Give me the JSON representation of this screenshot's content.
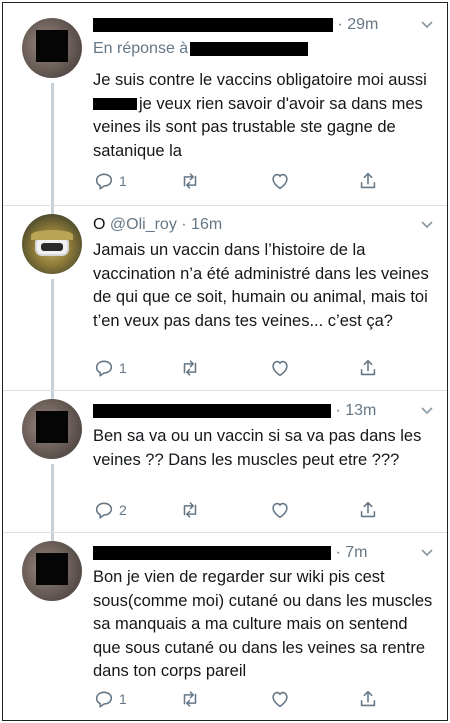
{
  "tweets": [
    {
      "name": "",
      "handle": "",
      "time": "· 29m",
      "reply_prefix": "En réponse à",
      "text_before": "Je suis contre le vaccins obligatoire moi aussi ",
      "text_after": "je veux rien savoir d'avoir sa dans mes veines ils sont pas trustable ste gagne de satanique la",
      "replies": "1",
      "retweets": "",
      "likes": ""
    },
    {
      "name": "O",
      "handle": "@Oli_roy",
      "time": "· 16m",
      "text": "Jamais un vaccin dans l’histoire de la vaccination n’a été administré dans les veines de qui que ce soit, humain ou animal, mais toi t’en veux pas dans tes veines... c’est ça?",
      "replies": "1",
      "retweets": "",
      "likes": ""
    },
    {
      "name": "",
      "handle": "",
      "time": "· 13m",
      "text": "Ben sa va ou un vaccin si sa va pas dans les veines ?? Dans les muscles peut etre ???",
      "replies": "2",
      "retweets": "",
      "likes": ""
    },
    {
      "name": "",
      "handle": "",
      "time": "· 7m",
      "text": "Bon je vien de regarder sur wiki pis cest sous(comme moi) cutané ou dans les muscles sa manquais a ma culture mais on sentend que sous cutané ou dans les veines sa rentre dans ton corps pareil",
      "replies": "1",
      "retweets": "",
      "likes": ""
    }
  ],
  "icons": {
    "reply": "reply-icon",
    "retweet": "retweet-icon",
    "like": "heart-icon",
    "share": "share-icon",
    "menu": "chevron-down-icon"
  },
  "colors": {
    "text": "#14171a",
    "secondary": "#657786",
    "divider": "#dde1e4",
    "thread": "#c9d1d8"
  }
}
